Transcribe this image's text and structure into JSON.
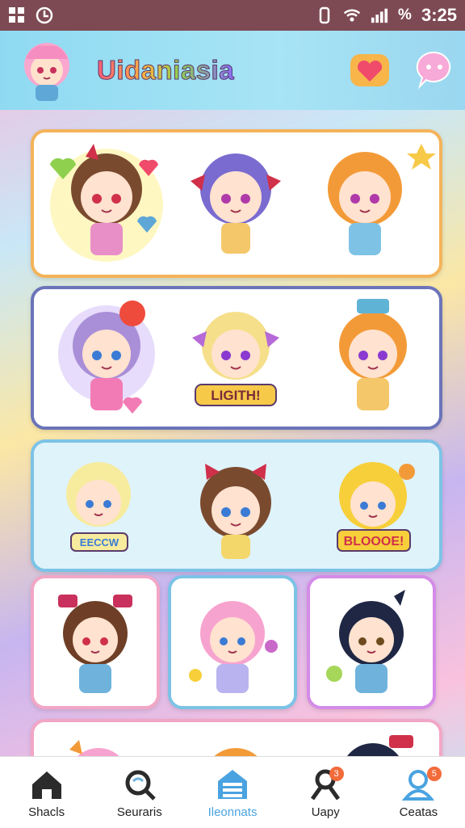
{
  "status_bar": {
    "battery": "%",
    "time": "3:25",
    "left_icons": [
      "grid-icon",
      "at-icon"
    ],
    "right_icons": [
      "vibrate-icon",
      "wifi-icon",
      "signal-icon"
    ]
  },
  "app_bar": {
    "title": "Uidaniasia",
    "actions": [
      "heart-icon",
      "chat-icon"
    ]
  },
  "stickers": {
    "row2_label": "LIGITH!",
    "row3_left_label": "EECCW",
    "row3_right_label": "BLOOOE!"
  },
  "bottom_nav": {
    "items": [
      {
        "label": "Shacls",
        "icon": "home-icon",
        "badge": ""
      },
      {
        "label": "Seuraris",
        "icon": "search-icon",
        "badge": ""
      },
      {
        "label": "Ileonnats",
        "icon": "collections-icon",
        "badge": ""
      },
      {
        "label": "Uapy",
        "icon": "person-icon",
        "badge": "3"
      },
      {
        "label": "Ceatas",
        "icon": "profile-icon",
        "badge": "5"
      }
    ],
    "active_index": 2
  },
  "colors": {
    "status_bar": "#7d4a53",
    "app_bar": "#8fdaf2",
    "active_nav": "#4aa3e0",
    "badge": "#f26b3a"
  }
}
